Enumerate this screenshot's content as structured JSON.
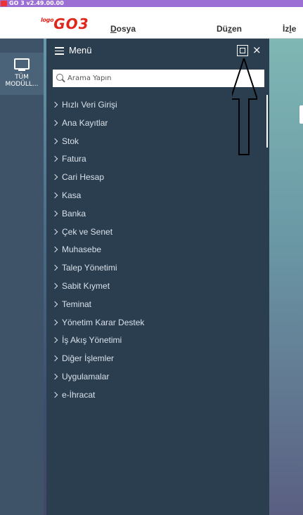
{
  "window": {
    "title": "GO 3 v2.49.00.00"
  },
  "logo": {
    "small": "logo",
    "main": "GO",
    "number": "3"
  },
  "menubar": {
    "items": [
      {
        "label": "Dosya",
        "accel": "D",
        "rest": "osya"
      },
      {
        "label": "Düzen",
        "pre": "Dü",
        "accel": "z",
        "rest": "en"
      },
      {
        "label": "İzle",
        "pre": "İz",
        "accel": "l",
        "rest": "e"
      }
    ]
  },
  "sidebar": {
    "all_modules_line1": "TÜM",
    "all_modules_line2": "MODÜLL..."
  },
  "panel": {
    "title": "Menü",
    "search_placeholder": "Arama Yapın",
    "items": [
      "Hızlı Veri Girişi",
      "Ana Kayıtlar",
      "Stok",
      "Fatura",
      "Cari Hesap",
      "Kasa",
      "Banka",
      "Çek ve Senet",
      "Muhasebe",
      "Talep Yönetimi",
      "Sabit Kıymet",
      "Teminat",
      "Yönetim Karar Destek",
      "İş Akış Yönetimi",
      "Diğer İşlemler",
      "Uygulamalar",
      "e-İhracat"
    ]
  },
  "colors": {
    "titlebar": "#9c6fd4",
    "panel": "#2b3e50",
    "logo_red": "#e0251b",
    "left_bar": "#3e5368"
  }
}
